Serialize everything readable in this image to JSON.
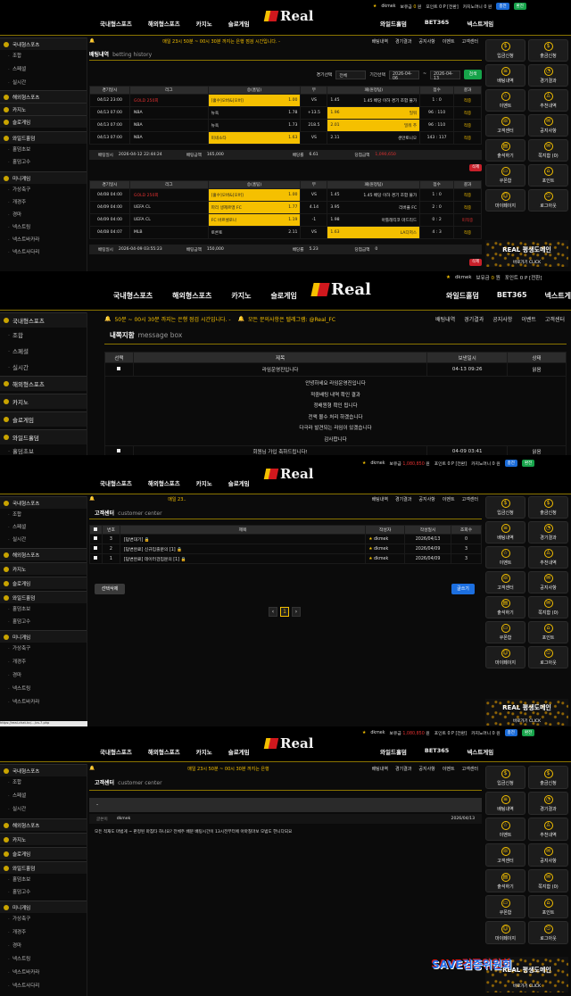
{
  "site": {
    "logo_text": "Real",
    "nav": [
      "국내형스포츠",
      "해외형스포츠",
      "카지노",
      "슬로게임"
    ],
    "nav_right": [
      "와일드홀덤",
      "BET365",
      "넥스트게임"
    ],
    "user": {
      "name": "dkmek",
      "cash_label": "보유금",
      "cash_s1": "0",
      "cash_s3": "1,080,850",
      "unit": "원",
      "point_label": "포인트",
      "point": "0 P [전환]",
      "casino_label": "카지노머니",
      "casino": "0 원",
      "badge_blue": "충전",
      "badge_green": "환전"
    }
  },
  "sidebar": {
    "domestic": "국내형스포츠",
    "domestic_items": [
      "조합",
      "스페셜",
      "실시간"
    ],
    "overseas": "해외형스포츠",
    "casino": "카지노",
    "slot": "슬로게임",
    "holdem": "와일드홀덤",
    "holdem_items": [
      "홀덤초보",
      "홀덤고수"
    ],
    "mini": "미니게임",
    "mini_items": [
      "가상축구",
      "개경주",
      "경마",
      "넥스트링",
      "넥스트바카라",
      "넥스트사다리"
    ]
  },
  "notice": {
    "s1": "매일 23시 50분 ~ 00시 30분 까지는 은행 점검 시간입니다. -",
    "s2": "50분 ~ 00시 30분 까지는 은행 점검 시간입니다. -",
    "s2_b": "모든 문의사항은 텔레그램: @Real_FC",
    "s3": "매일 23..",
    "s4": "매일 23시 50분 ~ 00시 30분 까지는 은행"
  },
  "topmenu": [
    "배팅내역",
    "경기결과",
    "공지사항",
    "이벤트",
    "고객센터"
  ],
  "right_panel": [
    "입금신청",
    "출금신청",
    "배팅내역",
    "경기결과",
    "이벤트",
    "추천내역",
    "고객센터",
    "공지사항",
    "출석하기",
    "쪽지함 (0)",
    "쿠폰함",
    "포인트",
    "마이페이지",
    "로그아웃"
  ],
  "right_icons": [
    "$",
    "$",
    "≡",
    "◔",
    "☆",
    "♙",
    "☏",
    "✉",
    "▤",
    "✉",
    "▭",
    "⌂",
    "☺",
    "⎋"
  ],
  "banner": {
    "line1": "REAL 평생도메인",
    "line2": "바로가기 CLICK"
  },
  "betting": {
    "title": "배팅내역",
    "subtitle": "betting history",
    "filter_label": "경기선택",
    "filter_value": "전체",
    "period_label": "기간선택",
    "date_from": "2026-04-06",
    "date_sep": "~",
    "date_to": "2026-04-13",
    "search_btn": "검색",
    "headers": [
      "경기일시",
      "리그",
      "승(홈팀)",
      "무",
      "패(원정팀)",
      "점수",
      "결과"
    ],
    "slip1": [
      {
        "date": "04/12 23:00",
        "league": "GOLD 250회",
        "home": "[홀수]오버&[오버]",
        "ho": "1.00",
        "mid": "VS",
        "ao": "1.45",
        "away": "1.45 배당 이하 경기 조합 불가",
        "score": "1 : 0",
        "res": "적중"
      },
      {
        "date": "04/13 07:00",
        "league": "NBA",
        "home": "뉴욕",
        "ho": "1.78",
        "mid": "+13.5",
        "ao": "1.96",
        "away": "밀워",
        "score": "96 : 110",
        "res": "적중"
      },
      {
        "date": "04/13 07:00",
        "league": "NBA",
        "home": "뉴욕",
        "ho": "1.73",
        "mid": "218.5",
        "ao": "2.01",
        "away": "밀워 추",
        "score": "96 : 110",
        "res": "적중"
      },
      {
        "date": "04/13 07:00",
        "league": "NBA",
        "home": "미네소타",
        "ho": "1.63",
        "mid": "VS",
        "ao": "2.11",
        "away": "샌안토니오",
        "score": "143 : 117",
        "res": "적중"
      }
    ],
    "slip1_foot": {
      "bet_time_label": "배팅일시",
      "bet_time": "2026-04-12 22:44:24",
      "amount_label": "배팅금액",
      "amount": "165,000",
      "odds_label": "배당률",
      "odds": "6.61",
      "win_label": "당첨금액",
      "win": "1,090,650"
    },
    "delete_btn": "삭제",
    "slip2": [
      {
        "date": "04/08 04:00",
        "league": "GOLD 250회",
        "home": "[홀수]오버&[오버]",
        "ho": "1.00",
        "mid": "VS",
        "ao": "1.45",
        "away": "1.45 배당 이하 경기 조합 불가",
        "score": "1 : 0",
        "res": "적중"
      },
      {
        "date": "04/09 04:00",
        "league": "UEFA CL",
        "home": "파리 생제르맹 FC",
        "ho": "1.77",
        "mid": "4.14",
        "ao": "3.95",
        "away": "리버풀 FC",
        "score": "2 : 0",
        "res": "적중"
      },
      {
        "date": "04/09 04:00",
        "league": "UEFA CL",
        "home": "FC 바르셀로나",
        "ho": "1.19",
        "mid": "-1",
        "ao": "1.98",
        "away": "아틀레티코 마드리드",
        "score": "0 : 2",
        "res": "미적중"
      },
      {
        "date": "04/08 04:07",
        "league": "MLB",
        "home": "토론토",
        "ho": "2.11",
        "mid": "VS",
        "ao": "1.63",
        "away": "LA다저스",
        "score": "4 : 3",
        "res": "적중"
      }
    ],
    "slip2_foot": {
      "bet_time": "2026-04-09 03:55:23",
      "amount": "150,000",
      "odds": "5.23",
      "win": "0"
    }
  },
  "messages": {
    "title": "내쪽지함",
    "subtitle": "message box",
    "headers": [
      "선택",
      "제목",
      "보낸일시",
      "상태"
    ],
    "row1": {
      "title": "라임운영진입니다",
      "date": "04-13 09:26",
      "state": "읽음"
    },
    "body": [
      "안녕하세요 라임운영진입니다",
      "적중배팅 내역 확인 결과",
      "정배원형 확인 됩니다",
      "전액 몰수 처리 하겠습니다",
      "다극라 발견되는 라임이 있겠습니다",
      "감사합니다"
    ],
    "row2": {
      "title": "회원님 가입 축하드립니다!",
      "date": "04-09 03:41",
      "state": "읽음"
    }
  },
  "customer": {
    "title": "고객센터",
    "subtitle": "customer center",
    "headers": [
      "번호",
      "제목",
      "작성자",
      "작성일시",
      "조회수"
    ],
    "rows": [
      {
        "no": "3",
        "title": "[답변대기] 🔒",
        "writer": "dkmek",
        "date": "2026/04/13",
        "views": "0"
      },
      {
        "no": "2",
        "title": "[답변완료] 신규입출문의 [1] 🔒",
        "writer": "dkmek",
        "date": "2026/04/09",
        "views": "3"
      },
      {
        "no": "1",
        "title": "[답변완료] 데이터검입문의 [1] 🔒",
        "writer": "dkmek",
        "date": "2026/04/09",
        "views": "3"
      }
    ],
    "del_btn": "선택삭제",
    "write_btn": "글쓰기",
    "page": "1",
    "prev": "‹",
    "next": "›"
  },
  "customer_detail": {
    "title": "고객센터",
    "subtitle": "customer center",
    "dash": "-",
    "writer_label": "글쓴이",
    "writer": "dkmek",
    "date": "2026/04/13",
    "body": "모든 적재도 마법게 ~ 판정된 마침타 하나요? 전체주 배분 배팅시간이 13시전부터에 아마칠마보 모범도 한니다되요"
  },
  "status_url": "https://real-chat.kc/.../cs-7.php",
  "watermark": "SAVE검증위원회"
}
